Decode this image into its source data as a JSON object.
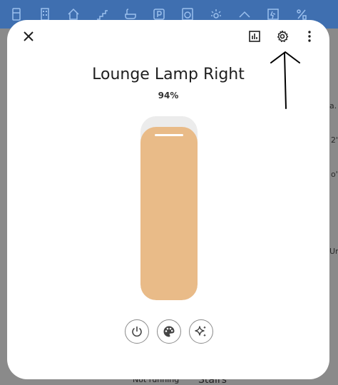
{
  "topbar": {
    "icons": [
      "fridge-icon",
      "building-icon",
      "home-icon",
      "stairs-icon",
      "bathtub-icon",
      "parking-icon",
      "washing-machine-icon",
      "sun-icon",
      "hill-icon",
      "exit-icon",
      "fraction-icon"
    ]
  },
  "background": {
    "side_texts": [
      "a.",
      "2'",
      "o'",
      "Un"
    ],
    "bottom_left": "Not running",
    "bottom_right": "Stairs"
  },
  "dialog": {
    "title": "Lounge Lamp Right",
    "brightness_text": "94%",
    "brightness_value": 94,
    "fill_color": "#e9bb88",
    "track_color": "#ececec"
  },
  "colors": {
    "topbar": "#3f6fb0",
    "overlay": "#7b7b7b"
  }
}
